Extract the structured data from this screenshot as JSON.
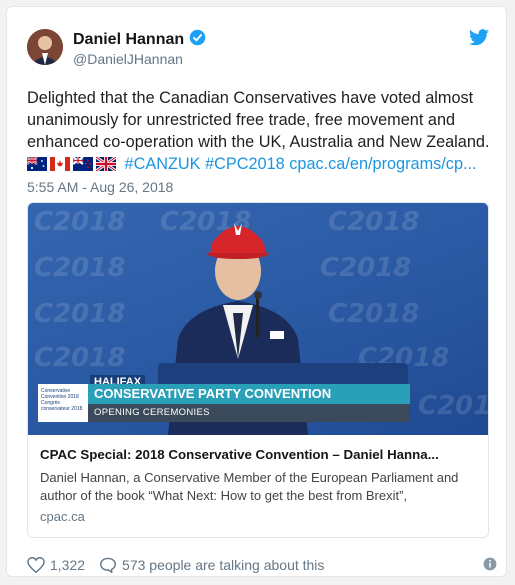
{
  "author": {
    "display_name": "Daniel Hannan",
    "handle": "@DanielJHannan",
    "avatar_icon": "profile-photo",
    "verified_icon": "verified-badge-icon"
  },
  "tweet": {
    "text_line": "Delighted that the Canadian Conservatives have voted almost unanimously for unrestricted free trade, free movement and enhanced co-operation with the UK, Australia and New Zealand.",
    "flags": [
      "australia-flag",
      "canada-flag",
      "new-zealand-flag",
      "uk-flag"
    ],
    "hashtag1": "#CANZUK",
    "hashtag2": "#CPC2018",
    "link": "cpac.ca/en/programs/cp...",
    "timestamp": "5:55 AM - Aug 26, 2018"
  },
  "link_card": {
    "media": {
      "background_text": "C2018",
      "banner_tag": "HALIFAX",
      "banner_logo_text": "Conservative Convention 2018 Congrès conservateur 2018",
      "banner_title": "CONSERVATIVE PARTY CONVENTION",
      "banner_subtitle": "OPENING CEREMONIES"
    },
    "title": "CPAC Special: 2018 Conservative Convention – Daniel Hanna...",
    "description": "Daniel Hannan, a Conservative Member of the European Parliament and author of the book “What Next: How to get the best from Brexit”,",
    "domain": "cpac.ca"
  },
  "footer": {
    "likes": "1,322",
    "talking": "573 people are talking about this"
  },
  "colors": {
    "accent": "#1b95e0",
    "verified": "#1da1f2"
  }
}
